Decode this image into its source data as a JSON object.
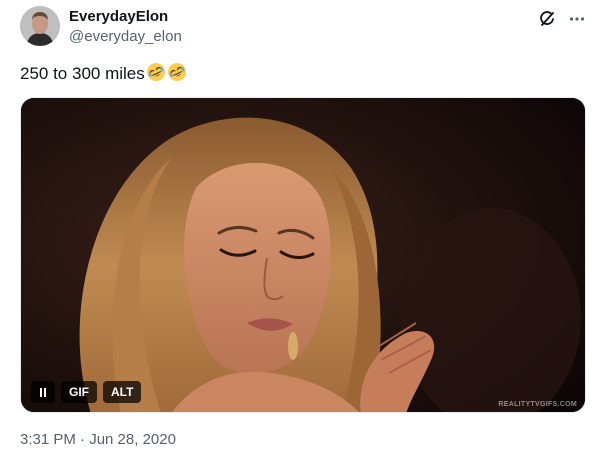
{
  "author": {
    "display_name": "EverydayElon",
    "handle": "@everyday_elon"
  },
  "header_icons": [
    "grok-icon",
    "more-icon"
  ],
  "tweet": {
    "text": "250 to 300 miles",
    "emojis": [
      "rolling-on-floor-laughing",
      "rolling-on-floor-laughing"
    ]
  },
  "media": {
    "controls": {
      "pause_icon": "pause-icon",
      "gif_label": "GIF",
      "alt_label": "ALT"
    },
    "watermark": "REALITYTVGIFS.COM"
  },
  "timestamp": "3:31 PM · Jun 28, 2020"
}
